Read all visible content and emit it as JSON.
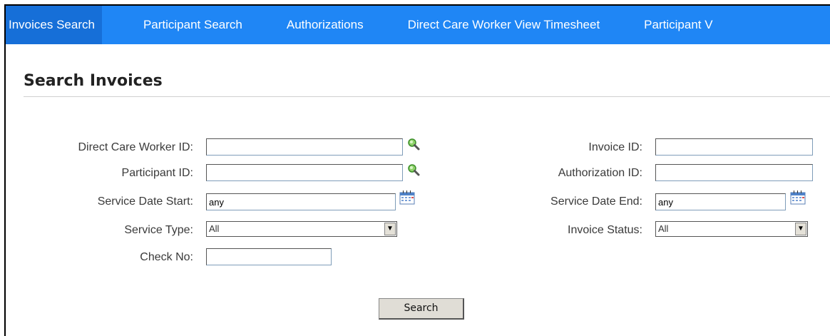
{
  "nav": {
    "tabs": [
      {
        "label": "Invoices Search"
      },
      {
        "label": "Participant Search"
      },
      {
        "label": "Authorizations"
      },
      {
        "label": "Direct Care Worker View Timesheet"
      },
      {
        "label": "Participant V"
      }
    ]
  },
  "page": {
    "title": "Search Invoices"
  },
  "form": {
    "dcw_id_label": "Direct Care Worker ID:",
    "participant_id_label": "Participant ID:",
    "service_date_start_label": "Service Date Start:",
    "service_date_start_value": "any",
    "service_type_label": "Service Type:",
    "service_type_value": "All",
    "check_no_label": "Check No:",
    "invoice_id_label": "Invoice ID:",
    "authorization_id_label": "Authorization ID:",
    "service_date_end_label": "Service Date End:",
    "service_date_end_value": "any",
    "invoice_status_label": "Invoice Status:",
    "invoice_status_value": "All",
    "search_button_label": "Search"
  },
  "icons": {
    "lookup": "magnifier-icon",
    "calendar": "calendar-icon"
  },
  "colors": {
    "nav_bg": "#1f86f5",
    "nav_active": "#166fd8"
  }
}
